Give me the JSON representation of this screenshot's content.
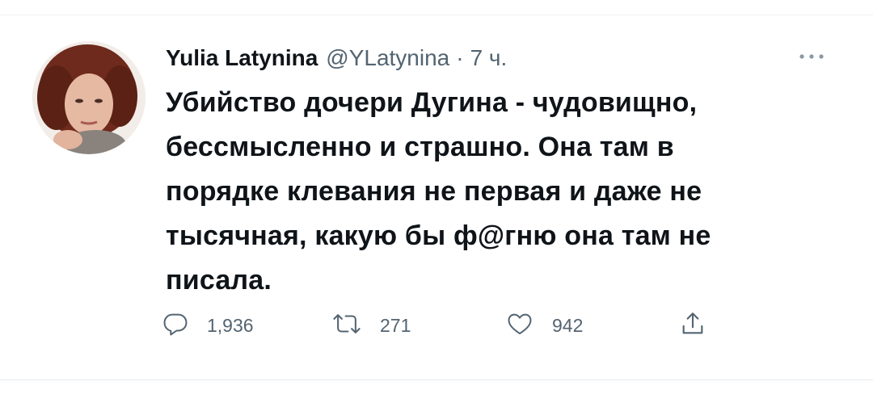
{
  "tweet": {
    "display_name": "Yulia Latynina",
    "handle": "@YLatynina",
    "separator": "·",
    "time": "7 ч.",
    "text": "Убийство дочери Дугина - чудовищно,\nбессмысленно и страшно. Она там в\nпорядке клевания не первая и даже не\nтысячная, какую бы ф@гню она там не\nписала."
  },
  "actions": {
    "reply_count": "1,936",
    "retweet_count": "271",
    "like_count": "942"
  },
  "icons": {
    "more": "more-horizontal-icon",
    "reply": "reply-icon",
    "retweet": "retweet-icon",
    "like": "heart-icon",
    "share": "share-icon"
  },
  "colors": {
    "text_primary": "#0f1419",
    "text_secondary": "#536471",
    "divider": "#eff3f4"
  }
}
